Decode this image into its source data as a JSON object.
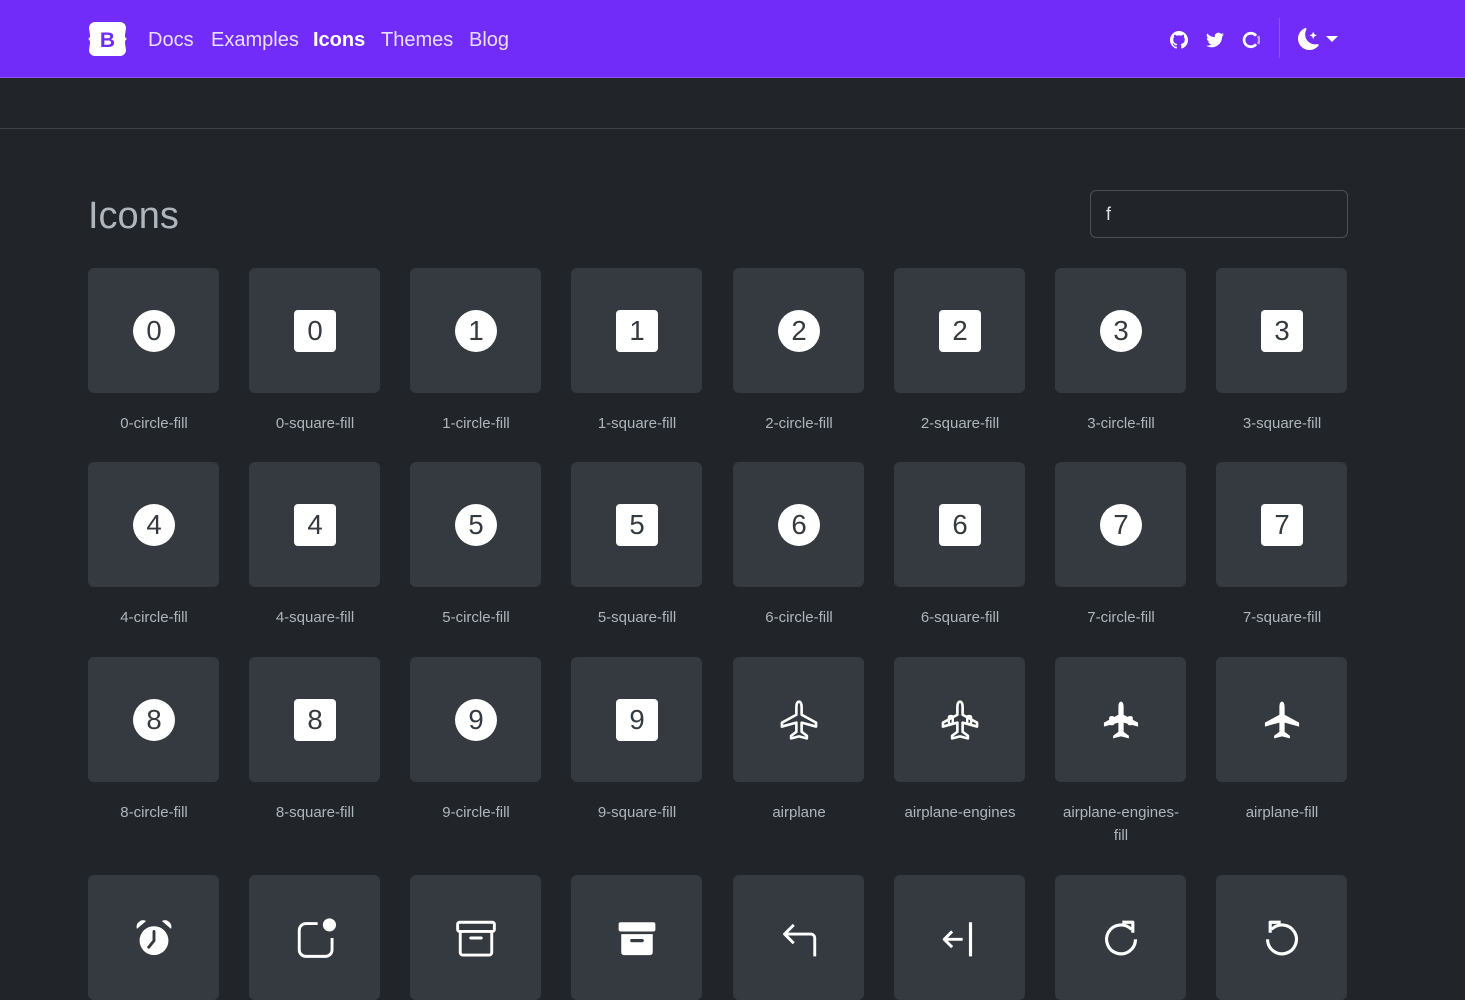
{
  "navbar": {
    "brand": "B",
    "links": [
      {
        "label": "Docs",
        "active": false
      },
      {
        "label": "Examples",
        "active": false
      },
      {
        "label": "Icons",
        "active": true
      },
      {
        "label": "Themes",
        "active": false
      },
      {
        "label": "Blog",
        "active": false
      }
    ],
    "social_icons": [
      "github-icon",
      "twitter-icon",
      "opencollective-icon"
    ],
    "theme_toggle_icon": "moon-stars-icon",
    "accent_color": "#712cf9"
  },
  "main": {
    "title": "Icons",
    "search": {
      "value": "f",
      "placeholder": ""
    }
  },
  "icons": [
    {
      "name": "0-circle-fill",
      "glyph": "0",
      "shape": "circle"
    },
    {
      "name": "0-square-fill",
      "glyph": "0",
      "shape": "square"
    },
    {
      "name": "1-circle-fill",
      "glyph": "1",
      "shape": "circle"
    },
    {
      "name": "1-square-fill",
      "glyph": "1",
      "shape": "square"
    },
    {
      "name": "2-circle-fill",
      "glyph": "2",
      "shape": "circle"
    },
    {
      "name": "2-square-fill",
      "glyph": "2",
      "shape": "square"
    },
    {
      "name": "3-circle-fill",
      "glyph": "3",
      "shape": "circle"
    },
    {
      "name": "3-square-fill",
      "glyph": "3",
      "shape": "square"
    },
    {
      "name": "4-circle-fill",
      "glyph": "4",
      "shape": "circle"
    },
    {
      "name": "4-square-fill",
      "glyph": "4",
      "shape": "square"
    },
    {
      "name": "5-circle-fill",
      "glyph": "5",
      "shape": "circle"
    },
    {
      "name": "5-square-fill",
      "glyph": "5",
      "shape": "square"
    },
    {
      "name": "6-circle-fill",
      "glyph": "6",
      "shape": "circle"
    },
    {
      "name": "6-square-fill",
      "glyph": "6",
      "shape": "square"
    },
    {
      "name": "7-circle-fill",
      "glyph": "7",
      "shape": "circle"
    },
    {
      "name": "7-square-fill",
      "glyph": "7",
      "shape": "square"
    },
    {
      "name": "8-circle-fill",
      "glyph": "8",
      "shape": "circle"
    },
    {
      "name": "8-square-fill",
      "glyph": "8",
      "shape": "square"
    },
    {
      "name": "9-circle-fill",
      "glyph": "9",
      "shape": "circle"
    },
    {
      "name": "9-square-fill",
      "glyph": "9",
      "shape": "square"
    },
    {
      "name": "airplane",
      "shape": "airplane"
    },
    {
      "name": "airplane-engines",
      "shape": "airplane-engines"
    },
    {
      "name": "airplane-engines-fill",
      "shape": "airplane-engines-fill"
    },
    {
      "name": "airplane-fill",
      "shape": "airplane-fill"
    },
    {
      "name": "",
      "shape": "alarm-fill"
    },
    {
      "name": "",
      "shape": "app-indicator"
    },
    {
      "name": "",
      "shape": "archive"
    },
    {
      "name": "",
      "shape": "archive-fill"
    },
    {
      "name": "",
      "shape": "arrow-90deg-left"
    },
    {
      "name": "",
      "shape": "arrow-bar-left"
    },
    {
      "name": "",
      "shape": "arrow-clockwise"
    },
    {
      "name": "",
      "shape": "arrow-counterclockwise"
    }
  ]
}
